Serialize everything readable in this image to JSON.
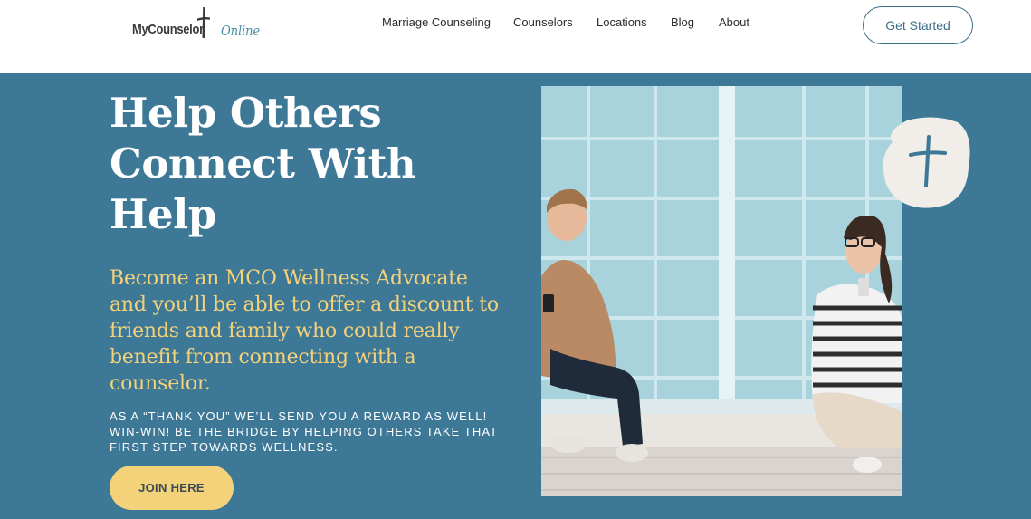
{
  "header": {
    "logo": {
      "part1": "MyCounselor",
      "part2": "Online"
    },
    "nav": [
      {
        "label": "Marriage Counseling"
      },
      {
        "label": "Counselors"
      },
      {
        "label": "Locations"
      },
      {
        "label": "Blog"
      },
      {
        "label": "About"
      }
    ],
    "cta_label": "Get Started"
  },
  "hero": {
    "title_lines": [
      "Help Others",
      "Connect With",
      "Help"
    ],
    "subtitle": "Become an MCO Wellness Advocate and you’ll be able to offer a discount to friends and family who could really benefit from connecting with a counselor.",
    "body": "As a “thank you” we’ll send you a reward as well! Win-win! Be the bridge by helping others take that first step towards wellness.",
    "join_label": "JOIN HERE",
    "badge_icon": "cross-icon",
    "photo_icon": "people-photo"
  },
  "colors": {
    "hero_bg": "#3e7897",
    "accent_yellow": "#f3d27a",
    "brand_blue": "#3d6e87",
    "badge_bg": "#f1eeea"
  }
}
